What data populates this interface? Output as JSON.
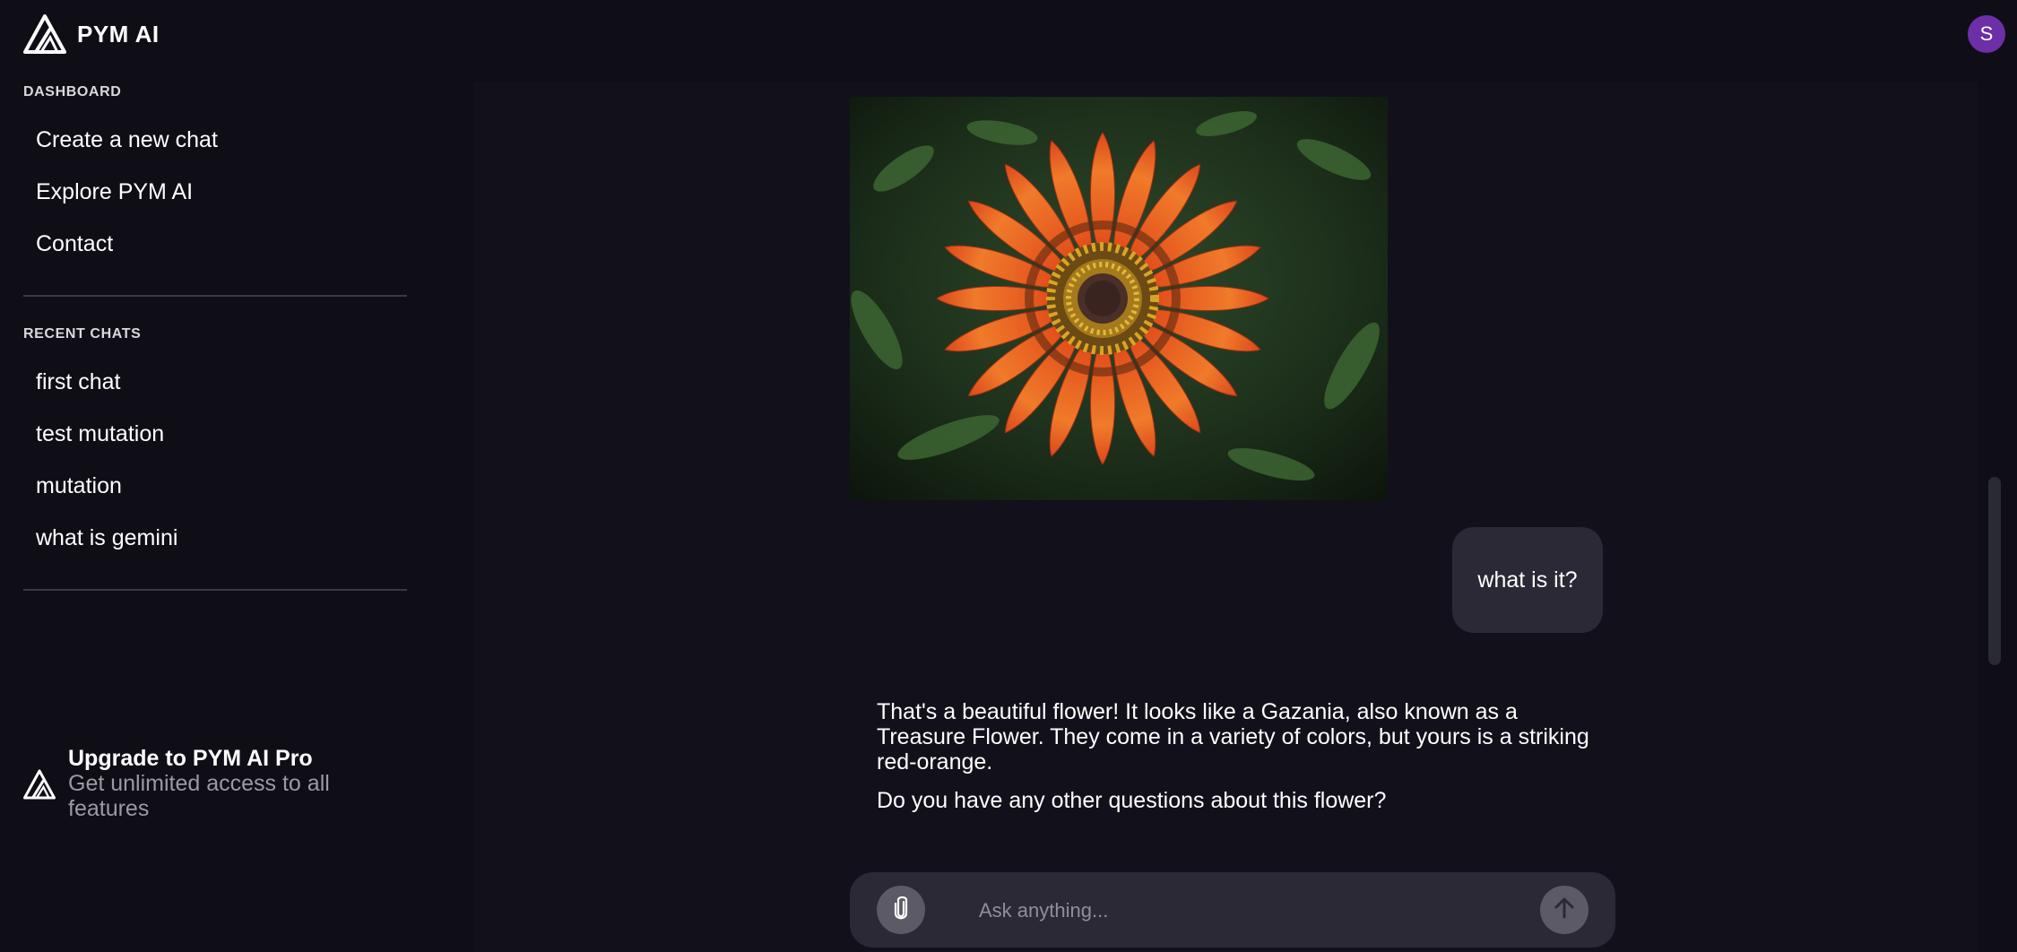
{
  "app": {
    "name": "PYM AI",
    "user_initial": "S"
  },
  "sidebar": {
    "dashboard_title": "DASHBOARD",
    "dashboard_items": [
      {
        "label": "Create a new chat"
      },
      {
        "label": "Explore PYM AI"
      },
      {
        "label": "Contact"
      }
    ],
    "recent_title": "RECENT CHATS",
    "recent_items": [
      {
        "label": "first chat"
      },
      {
        "label": "test mutation"
      },
      {
        "label": "mutation"
      },
      {
        "label": "what is gemini"
      }
    ],
    "upgrade": {
      "title": "Upgrade to PYM AI Pro",
      "subtitle": "Get unlimited access to all features"
    }
  },
  "chat": {
    "user_message": "what is it?",
    "ai_paragraphs": [
      "That's a beautiful flower! It looks like a Gazania, also known as a Treasure Flower. They come in a variety of colors, but yours is a striking red-orange.",
      "Do you have any other questions about this flower?"
    ]
  },
  "composer": {
    "placeholder": "Ask anything..."
  },
  "colors": {
    "background": "#0f0e17",
    "panel": "#12111b",
    "bubble": "#2a2935",
    "avatar": "#6d2fa8"
  }
}
